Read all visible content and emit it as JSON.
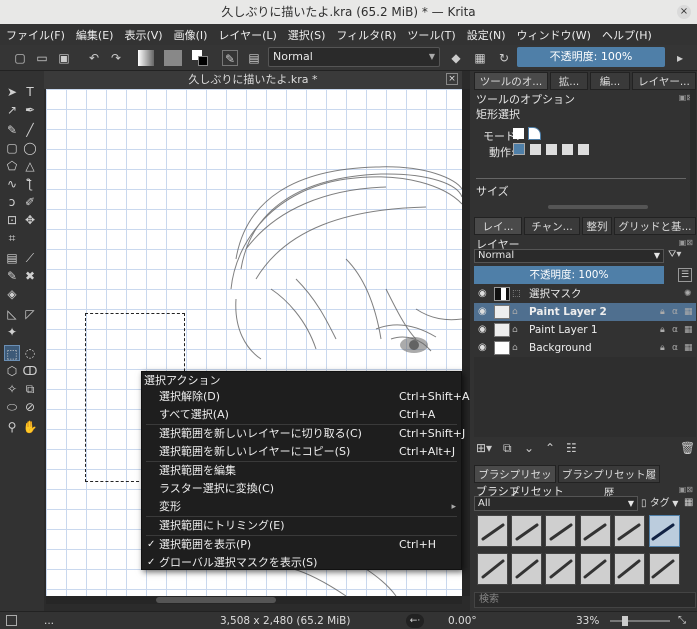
{
  "window": {
    "title": "久しぶりに描いたよ.kra (65.2 MiB) * — Krita",
    "close": "×"
  },
  "menubar": [
    "ファイル(F)",
    "編集(E)",
    "表示(V)",
    "画像(I)",
    "レイヤー(L)",
    "選択(S)",
    "フィルタ(R)",
    "ツール(T)",
    "設定(N)",
    "ウィンドウ(W)",
    "ヘルプ(H)"
  ],
  "toolbar": {
    "blend_mode": "Normal",
    "opacity": "不透明度: 100%"
  },
  "document": {
    "tab_title": "久しぶりに描いたよ.kra *",
    "close": "×"
  },
  "context_menu": {
    "header": "選択アクション",
    "items": [
      {
        "label": "選択解除(D)",
        "shortcut": "Ctrl+Shift+A"
      },
      {
        "label": "すべて選択(A)",
        "shortcut": "Ctrl+A"
      },
      {
        "label": "選択範囲を新しいレイヤーに切り取る(C)",
        "shortcut": "Ctrl+Shift+J"
      },
      {
        "label": "選択範囲を新しいレイヤーにコピー(S)",
        "shortcut": "Ctrl+Alt+J"
      },
      {
        "label": "選択範囲を編集",
        "shortcut": ""
      },
      {
        "label": "ラスター選択に変換(C)",
        "shortcut": ""
      },
      {
        "label": "変形",
        "shortcut": "",
        "submenu": "▸"
      },
      {
        "label": "選択範囲にトリミング(E)",
        "shortcut": ""
      },
      {
        "label": "選択範囲を表示(P)",
        "shortcut": "Ctrl+H",
        "checked": "✓"
      },
      {
        "label": "グローバル選択マスクを表示(S)",
        "shortcut": "",
        "checked": "✓"
      }
    ]
  },
  "tool_options": {
    "tabs": [
      "ツールのオ...",
      "拡...",
      "編...",
      "レイヤー..."
    ],
    "title": "ツールのオプション",
    "subtitle": "矩形選択",
    "mode_label": "モード:",
    "action_label": "動作:",
    "size_label": "サイズ"
  },
  "layers": {
    "tabs": [
      "レイ...",
      "チャン...",
      "整列",
      "グリッドと基..."
    ],
    "title": "レイヤー",
    "blend": "Normal",
    "opacity": "不透明度: 100%",
    "items": [
      {
        "name": "選択マスク"
      },
      {
        "name": "Paint Layer 2"
      },
      {
        "name": "Paint Layer 1"
      },
      {
        "name": "Background"
      }
    ]
  },
  "brushes": {
    "tabs": [
      "ブラシプリセット",
      "ブラシプリセット履歴"
    ],
    "title": "ブラシプリセット",
    "filter": "All",
    "tag": "タグ",
    "search_placeholder": "検索"
  },
  "status": {
    "left": "...",
    "size": "3,508 x 2,480 (65.2 MiB)",
    "angle": "0.00°",
    "zoom": "33%"
  }
}
